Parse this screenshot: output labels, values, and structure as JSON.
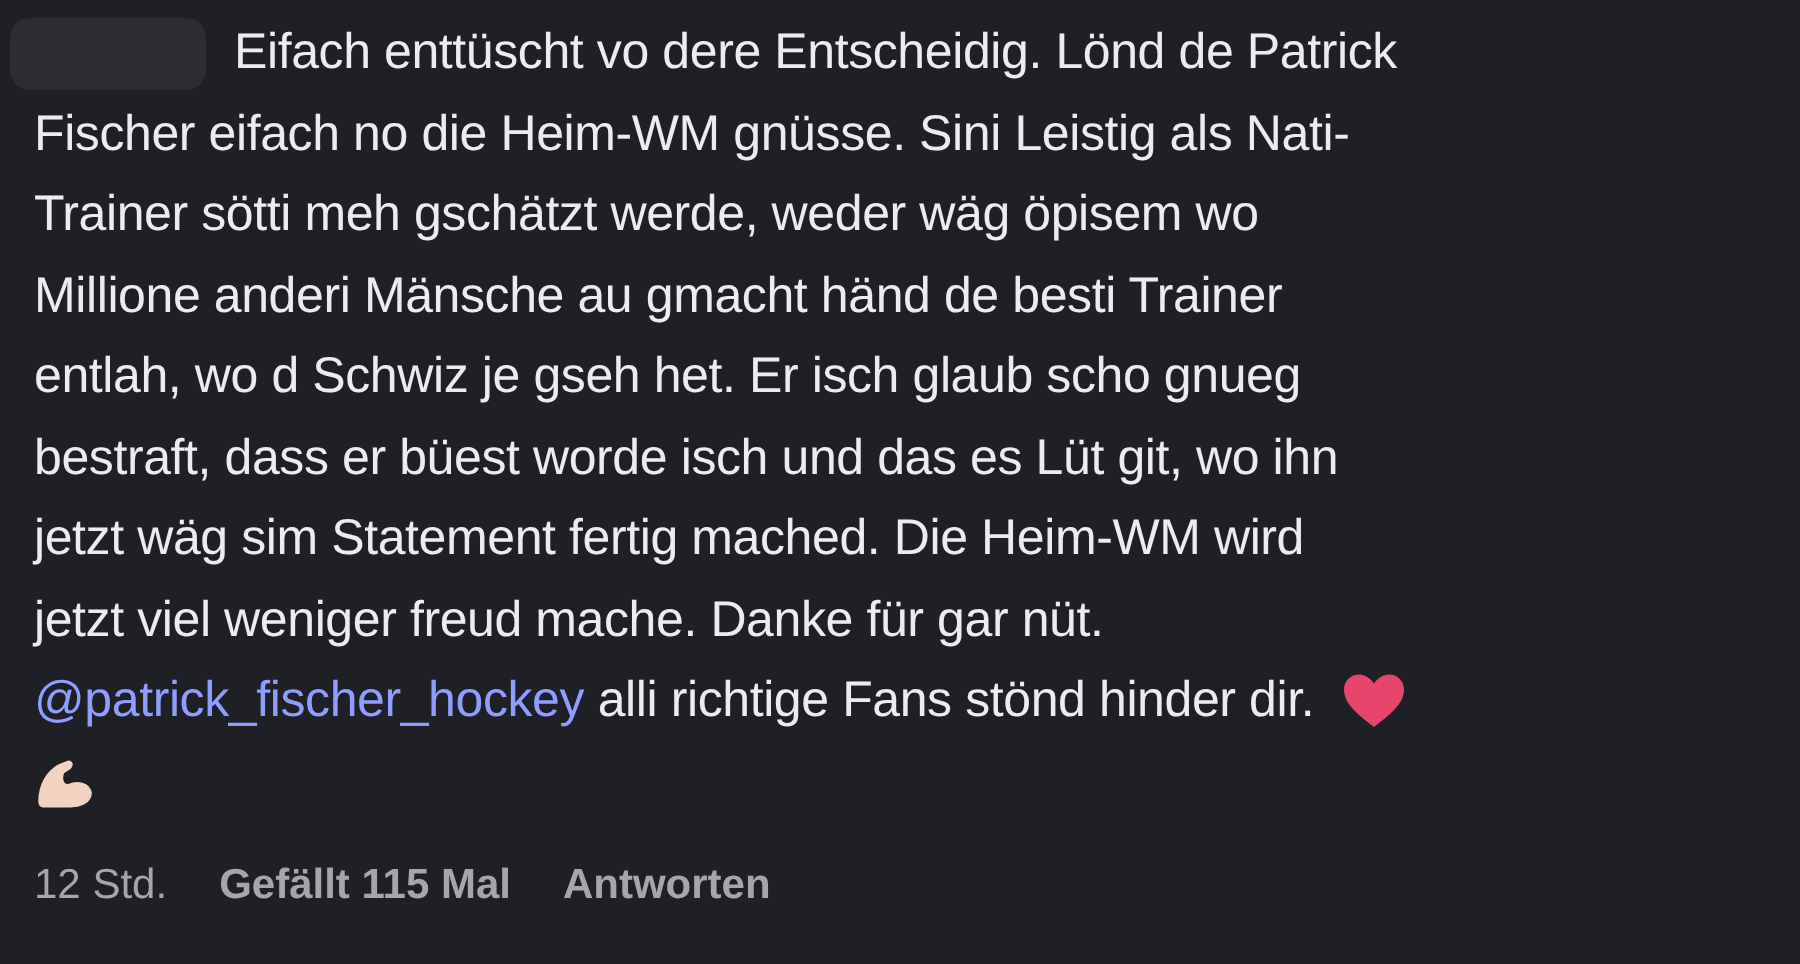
{
  "comment": {
    "lines": [
      "Eifach enttüscht vo dere Entscheidig. Lönd de Patrick",
      "Fischer eifach no die Heim-WM gnüsse. Sini Leistig als Nati-",
      "Trainer sötti meh gschätzt werde, weder wäg öpisem wo",
      "Millione anderi Mänsche au gmacht händ de besti Trainer",
      "entlah, wo d Schwiz je gseh het. Er isch glaub scho gnueg",
      "bestraft, dass er büest worde isch und das es Lüt git, wo ihn",
      "jetzt wäg sim Statement fertig mached. Die Heim-WM wird",
      "jetzt viel weniger freud mache. Danke für gar nüt."
    ],
    "mention": "@patrick_fischer_hockey",
    "mention_text": "alli richtige Fans stönd hinder dir."
  },
  "footer": {
    "time": "12 Std.",
    "likes": "Gefällt 115 Mal",
    "reply": "Antworten"
  }
}
